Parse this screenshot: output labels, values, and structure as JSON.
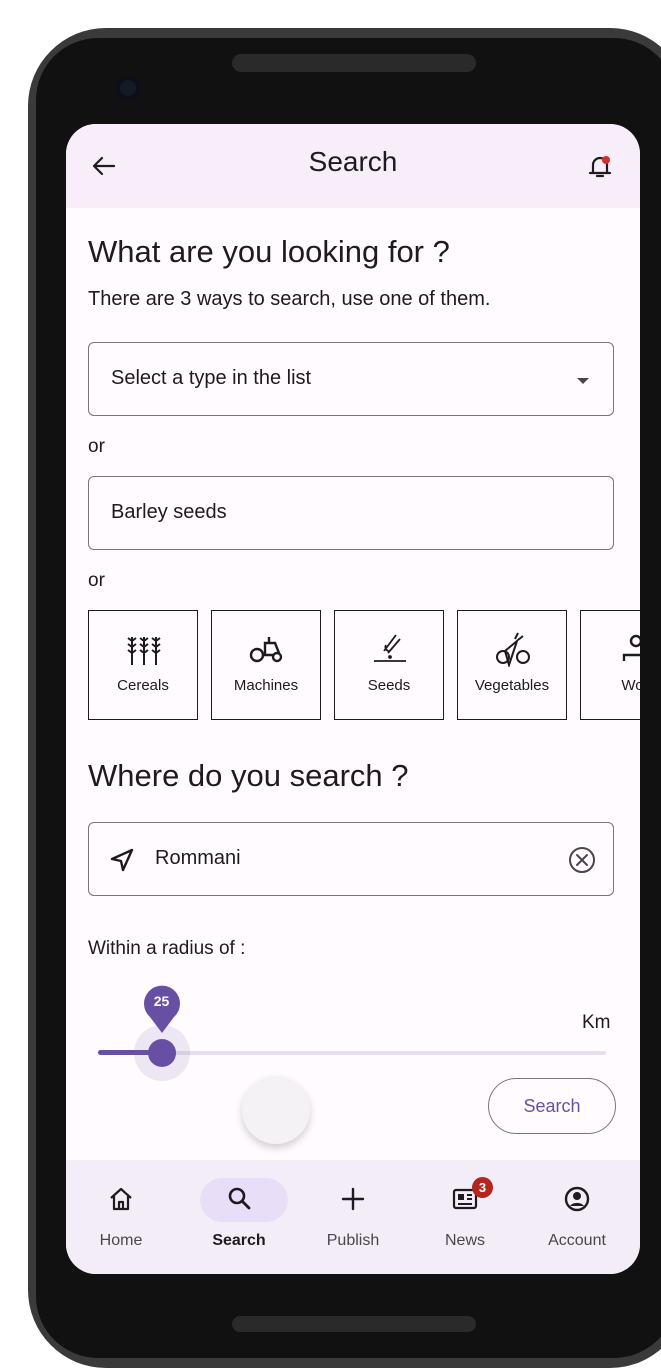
{
  "app_bar": {
    "title": "Search",
    "back_icon": "arrow-left-icon",
    "notification_icon": "bell-icon",
    "notification_dot_color": "#d32f2f"
  },
  "what_section": {
    "title": "What are you looking for ?",
    "subtitle": "There are 3 ways to search, use one of them.",
    "type_select": {
      "placeholder": "Select a type in the list",
      "icon": "dropdown-arrow-icon"
    },
    "or_1": "or",
    "keyword_input": {
      "value": "Barley seeds"
    },
    "or_2": "or",
    "categories": [
      {
        "label": "Cereals",
        "icon": "wheat-icon"
      },
      {
        "label": "Machines",
        "icon": "tractor-icon"
      },
      {
        "label": "Seeds",
        "icon": "sowing-icon"
      },
      {
        "label": "Vegetables",
        "icon": "vegetables-icon"
      },
      {
        "label": "Wor",
        "icon": "worker-icon"
      }
    ]
  },
  "where_section": {
    "title": "Where do you search ?",
    "location_input": {
      "value": "Rommani",
      "icon": "navigation-arrow-icon",
      "clear_icon": "clear-circle-icon"
    },
    "radius_label": "Within a radius of :",
    "radius": {
      "value": 25,
      "value_label": "25",
      "unit": "Km",
      "min": 0,
      "max": 200
    }
  },
  "search_button": {
    "label": "Search"
  },
  "bottom_nav": {
    "active": "Search",
    "items": [
      {
        "label": "Home",
        "icon": "home-icon"
      },
      {
        "label": "Search",
        "icon": "search-icon"
      },
      {
        "label": "Publish",
        "icon": "plus-icon"
      },
      {
        "label": "News",
        "icon": "news-icon",
        "badge": "3"
      },
      {
        "label": "Account",
        "icon": "account-circle-icon"
      }
    ]
  },
  "colors": {
    "primary": "#6750a4",
    "app_bar_bg": "#f7eef9",
    "nav_bg": "#f3edf7",
    "nav_pill": "#e8def8",
    "badge": "#b3261e"
  }
}
